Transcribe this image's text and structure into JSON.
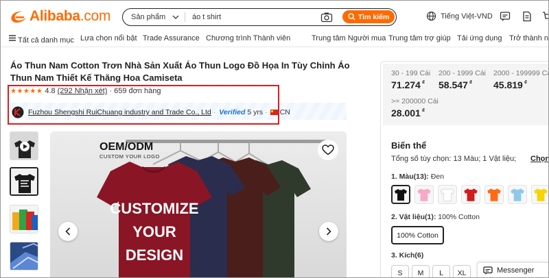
{
  "header": {
    "logo_text": "Alibaba",
    "logo_suffix": ".com",
    "search_category": "Sản phẩm",
    "search_value": "áo t shirt",
    "search_button": "Tìm kiếm",
    "language": "Tiếng Việt-VND"
  },
  "nav": {
    "all_categories": "Tất cả danh mục",
    "items": [
      "Lựa chọn nổi bật",
      "Trade Assurance",
      "Chương trình Thành viên"
    ],
    "right_items": [
      "Trung tâm Người mua",
      "Trung tâm trợ giúp",
      "Tải ứng dụng",
      "Trở thành nhà"
    ]
  },
  "product": {
    "title": "Áo Thun Nam Cotton Trơn Nhà Sản Xuất Áo Thun Logo Đồ Họa In Tùy Chỉnh Áo Thun Nam Thiết Kế Thăng Hoa Camiseta",
    "stars": "★★★★★",
    "rating": "4.8",
    "reviews": "(292 Nhận xét)",
    "orders": "· 659 đơn hàng",
    "supplier_name": "Fuzhou Shengshi RuiChuang industry and Trade Co., Ltd",
    "verified": "Verified",
    "years": "5 yrs",
    "country": "CN",
    "image_text": {
      "oem": "OEM/ODM",
      "custom_logo": "CUSTOM YOUR LOGO",
      "line1": "CUSTOMIZE",
      "line2": "YOUR",
      "line3": "DESIGN"
    }
  },
  "pricing": {
    "tiers": [
      {
        "range": "30 - 199 Cái",
        "price": "71.274",
        "currency": "₫"
      },
      {
        "range": "200 - 1999 Cái",
        "price": "58.547",
        "currency": "₫"
      },
      {
        "range": "2000 - 199999 Cái",
        "price": "45.819",
        "currency": "₫"
      },
      {
        "range": ">= 200000 Cái",
        "price": "28.001",
        "currency": "₫"
      }
    ]
  },
  "variants": {
    "heading": "Biến thể",
    "summary": "Tổng số tùy chọn: 13 Màu; 1 Vật liệu;",
    "choose_label": "Chọn",
    "color_label": "1. Màu(13):",
    "color_selected": "Đen",
    "colors": [
      "#111111",
      "#f7a9c6",
      "#ffffff",
      "#d41a1a",
      "#ff6a13",
      "#8ec9ec",
      "#f6d500"
    ],
    "material_label": "2. Vật liệu(1):",
    "material_selected": "100% Cotton",
    "material_option": "100% Cotton",
    "size_label": "3. Kích(6)",
    "sizes": [
      "S",
      "M",
      "L",
      "XL"
    ]
  },
  "messenger": {
    "label": "Messenger"
  }
}
